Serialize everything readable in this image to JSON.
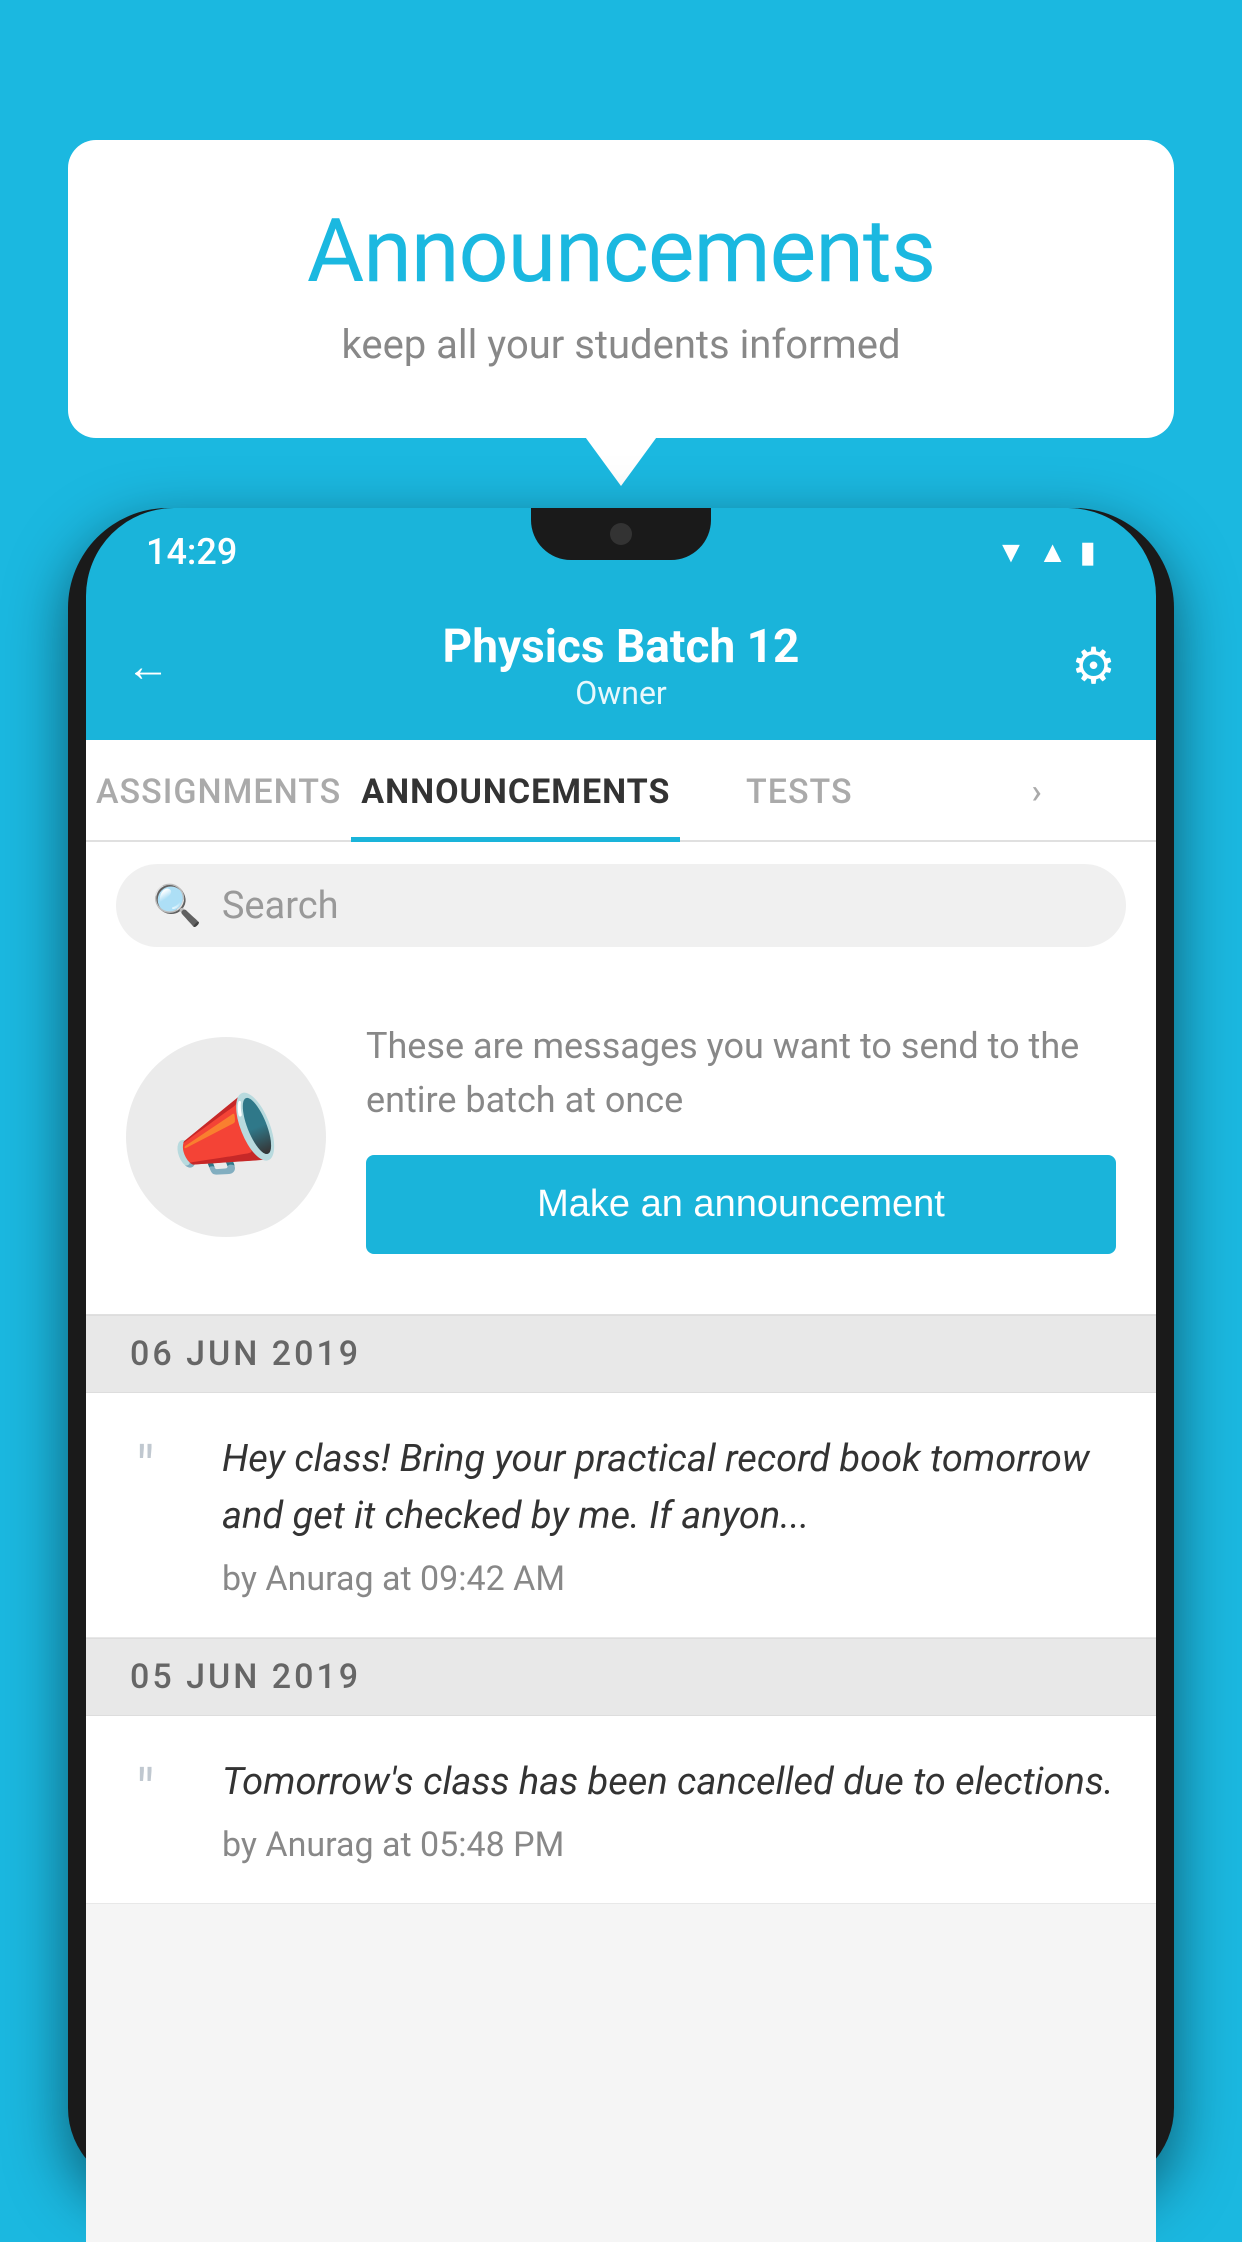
{
  "background_color": "#1bb8e0",
  "speech_bubble": {
    "title": "Announcements",
    "subtitle": "keep all your students informed"
  },
  "phone": {
    "status_bar": {
      "time": "14:29",
      "icons": [
        "wifi",
        "signal",
        "battery"
      ]
    },
    "header": {
      "title": "Physics Batch 12",
      "subtitle": "Owner",
      "back_label": "←",
      "gear_label": "⚙"
    },
    "tabs": [
      {
        "label": "ASSIGNMENTS",
        "active": false
      },
      {
        "label": "ANNOUNCEMENTS",
        "active": true
      },
      {
        "label": "TESTS",
        "active": false
      },
      {
        "label": "...",
        "active": false
      }
    ],
    "search": {
      "placeholder": "Search"
    },
    "announcement_prompt": {
      "description": "These are messages you want to send to the entire batch at once",
      "button_label": "Make an announcement"
    },
    "announcements": [
      {
        "date": "06  JUN  2019",
        "message": "Hey class! Bring your practical record book tomorrow and get it checked by me. If anyon...",
        "author": "by Anurag at 09:42 AM"
      },
      {
        "date": "05  JUN  2019",
        "message": "Tomorrow's class has been cancelled due to elections.",
        "author": "by Anurag at 05:48 PM"
      }
    ]
  }
}
